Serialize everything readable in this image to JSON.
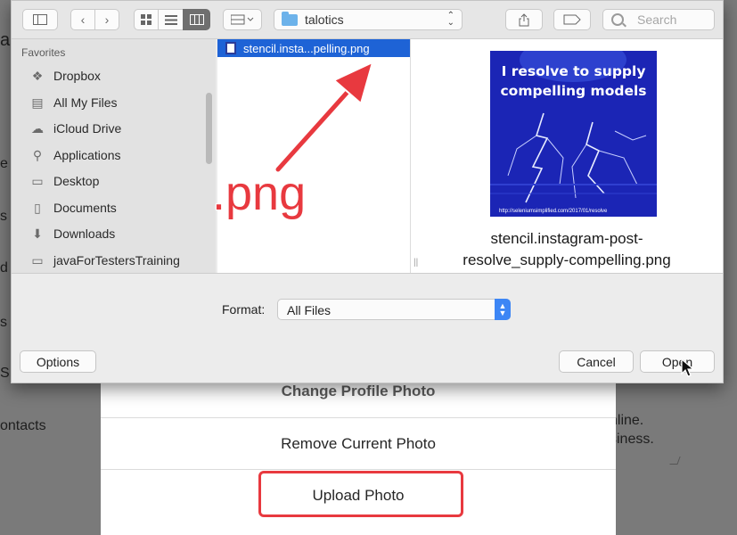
{
  "background": {
    "fragments": [
      "a",
      "e",
      "s",
      "d A",
      "s",
      "S",
      "ontacts",
      "nline.",
      "siness."
    ]
  },
  "modal": {
    "title": "Change Profile Photo",
    "remove": "Remove Current Photo",
    "upload": "Upload Photo"
  },
  "toolbar": {
    "sidebar_toggle_icon": "sidebar-icon",
    "back_icon": "chevron-left-icon",
    "forward_icon": "chevron-right-icon",
    "path": "talotics",
    "search_placeholder": "Search"
  },
  "sidebar": {
    "heading": "Favorites",
    "items": [
      {
        "label": "Dropbox",
        "icon": "dropbox-icon"
      },
      {
        "label": "All My Files",
        "icon": "all-files-icon"
      },
      {
        "label": "iCloud Drive",
        "icon": "cloud-icon"
      },
      {
        "label": "Applications",
        "icon": "applications-icon"
      },
      {
        "label": "Desktop",
        "icon": "desktop-icon"
      },
      {
        "label": "Documents",
        "icon": "documents-icon"
      },
      {
        "label": "Downloads",
        "icon": "downloads-icon"
      },
      {
        "label": "javaForTestersTraining",
        "icon": "folder-icon"
      }
    ]
  },
  "browser": {
    "selected_file": "stencil.insta...pelling.png"
  },
  "preview": {
    "image_text_line1": "I resolve to supply",
    "image_text_line2": "compelling models",
    "image_url": "http://seleniumsimplified.com/2017/01/resolve",
    "name_line1": "stencil.instagram-post-",
    "name_line2": "resolve_supply-compelling.png"
  },
  "format": {
    "label": "Format:",
    "value": "All Files"
  },
  "buttons": {
    "options": "Options",
    "cancel": "Cancel",
    "open": "Open"
  },
  "annotation": {
    "label": ".png",
    "color": "#e8393f"
  },
  "colors": {
    "selection": "#1e63d6",
    "accent": "#3d86f5"
  }
}
